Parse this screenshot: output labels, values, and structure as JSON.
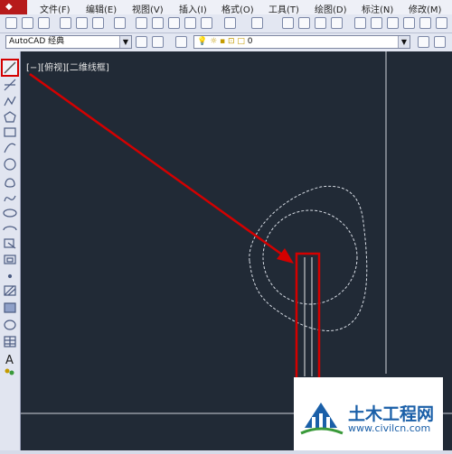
{
  "menubar": {
    "items": [
      "文件(F)",
      "编辑(E)",
      "视图(V)",
      "插入(I)",
      "格式(O)",
      "工具(T)",
      "绘图(D)",
      "标注(N)",
      "修改(M)"
    ]
  },
  "toolbar": {
    "workspace_value": "AutoCAD 经典",
    "layer_value": "0"
  },
  "canvas": {
    "viewport_label": "[−][俯视][二维线框]"
  },
  "watermark": {
    "title": "土木工程网",
    "url": "www.civilcn.com"
  },
  "colors": {
    "highlight": "#d40000",
    "canvas_bg": "#212a36",
    "geometry": "#e8e8e8",
    "brand_blue": "#1a5fa8"
  },
  "icons": [
    "line-icon",
    "construction-line-icon",
    "polyline-icon",
    "polygon-icon",
    "rectangle-icon",
    "arc-icon",
    "circle-icon",
    "revision-cloud-icon",
    "spline-icon",
    "ellipse-icon",
    "ellipse-arc-icon",
    "insert-block-icon",
    "make-block-icon",
    "point-icon",
    "hatch-icon",
    "gradient-icon",
    "region-icon",
    "table-icon",
    "multiline-text-icon",
    "add-selected-icon"
  ]
}
